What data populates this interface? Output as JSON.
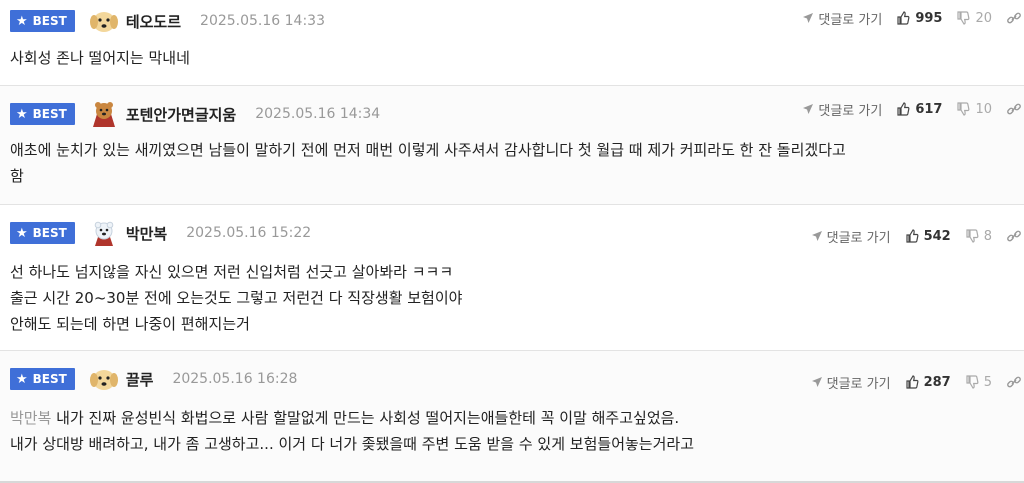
{
  "comments": [
    {
      "badge": "BEST",
      "nickname": "테오도르",
      "date": "2025.05.16 14:33",
      "reply_label": "댓글로 가기",
      "likes": "995",
      "dislikes": "20",
      "avatar": "puppy-icon",
      "text": "사회성 존나 떨어지는 막내네"
    },
    {
      "badge": "BEST",
      "nickname": "포텐안가면글지움",
      "date": "2025.05.16 14:34",
      "reply_label": "댓글로 가기",
      "likes": "617",
      "dislikes": "10",
      "avatar": "bear-cape-icon",
      "text": "애초에 눈치가 있는 새끼였으면 남들이 말하기 전에 먼저 매번 이렇게 사주셔서 감사합니다 첫 월급 때 제가 커피라도 한 잔 돌리겠다고\n함"
    },
    {
      "badge": "BEST",
      "nickname": "박만복",
      "date": "2025.05.16 15:22",
      "reply_label": "댓글로 가기",
      "likes": "542",
      "dislikes": "8",
      "avatar": "polar-bear-icon",
      "text": "선 하나도 넘지않을 자신 있으면 저런 신입처럼 선긋고 살아봐라 ㅋㅋㅋ\n출근 시간 20~30분 전에 오는것도 그렇고 저런건 다 직장생활 보험이야\n안해도 되는데 하면 나중이 편해지는거"
    },
    {
      "badge": "BEST",
      "nickname": "끌루",
      "date": "2025.05.16 16:28",
      "reply_label": "댓글로 가기",
      "likes": "287",
      "dislikes": "5",
      "avatar": "puppy-icon",
      "mention": "박만복",
      "text": " 내가 진짜 윤성빈식 화법으로 사람 할말없게 만드는 사회성 떨어지는애들한테 꼭 이말 해주고싶었음.\n내가 상대방 배려하고, 내가 좀 고생하고... 이거 다 너가 좆됐을때 주변 도움 받을 수 있게 보험들어놓는거라고"
    }
  ],
  "colors": {
    "badge": "#3f6fd8",
    "mention": "#999999",
    "date": "#999999"
  }
}
